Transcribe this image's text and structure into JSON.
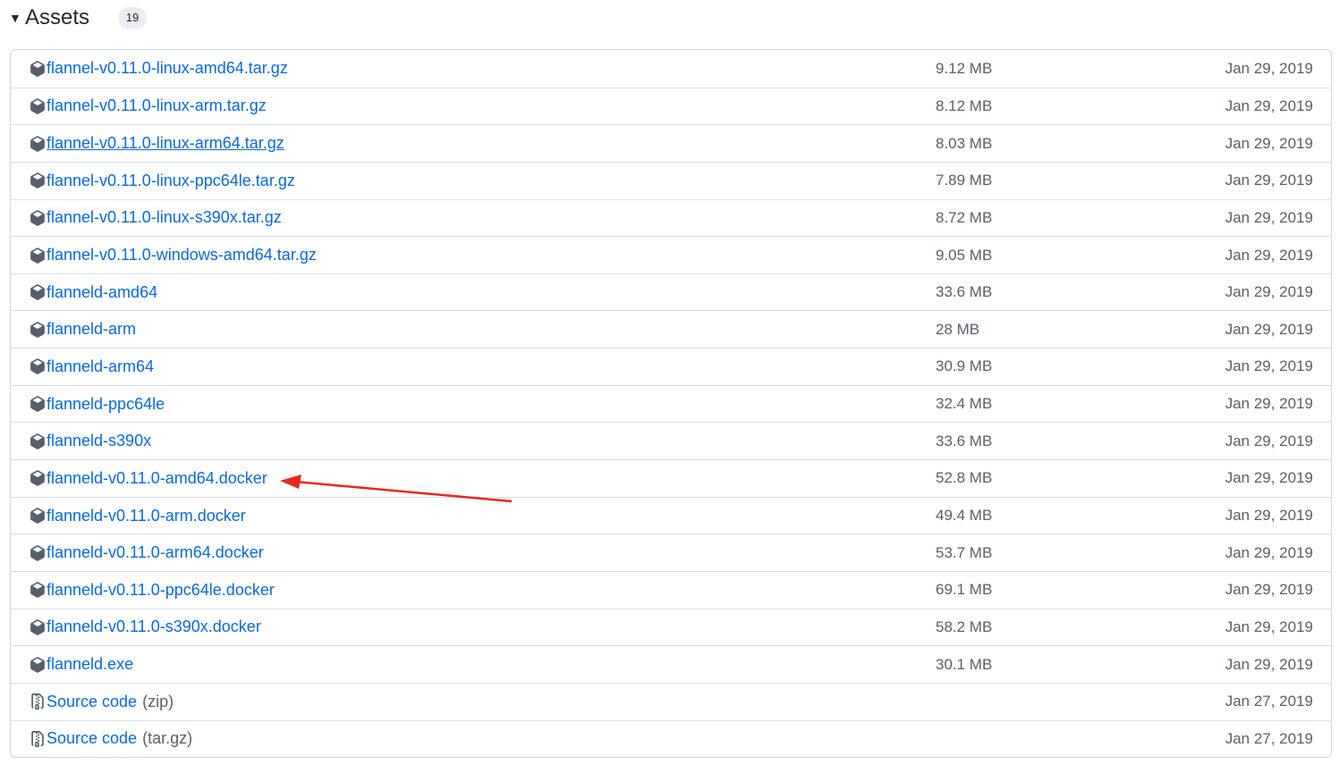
{
  "header": {
    "title": "Assets",
    "count": "19"
  },
  "assets": [
    {
      "name": "flannel-v0.11.0-linux-amd64.tar.gz",
      "size": "9.12 MB",
      "date": "Jan 29, 2019",
      "icon": "package-icon"
    },
    {
      "name": "flannel-v0.11.0-linux-arm.tar.gz",
      "size": "8.12 MB",
      "date": "Jan 29, 2019",
      "icon": "package-icon"
    },
    {
      "name": "flannel-v0.11.0-linux-arm64.tar.gz",
      "size": "8.03 MB",
      "date": "Jan 29, 2019",
      "icon": "package-icon",
      "hovered": true
    },
    {
      "name": "flannel-v0.11.0-linux-ppc64le.tar.gz",
      "size": "7.89 MB",
      "date": "Jan 29, 2019",
      "icon": "package-icon"
    },
    {
      "name": "flannel-v0.11.0-linux-s390x.tar.gz",
      "size": "8.72 MB",
      "date": "Jan 29, 2019",
      "icon": "package-icon"
    },
    {
      "name": "flannel-v0.11.0-windows-amd64.tar.gz",
      "size": "9.05 MB",
      "date": "Jan 29, 2019",
      "icon": "package-icon"
    },
    {
      "name": "flanneld-amd64",
      "size": "33.6 MB",
      "date": "Jan 29, 2019",
      "icon": "package-icon"
    },
    {
      "name": "flanneld-arm",
      "size": "28 MB",
      "date": "Jan 29, 2019",
      "icon": "package-icon"
    },
    {
      "name": "flanneld-arm64",
      "size": "30.9 MB",
      "date": "Jan 29, 2019",
      "icon": "package-icon"
    },
    {
      "name": "flanneld-ppc64le",
      "size": "32.4 MB",
      "date": "Jan 29, 2019",
      "icon": "package-icon"
    },
    {
      "name": "flanneld-s390x",
      "size": "33.6 MB",
      "date": "Jan 29, 2019",
      "icon": "package-icon"
    },
    {
      "name": "flanneld-v0.11.0-amd64.docker",
      "size": "52.8 MB",
      "date": "Jan 29, 2019",
      "icon": "package-icon"
    },
    {
      "name": "flanneld-v0.11.0-arm.docker",
      "size": "49.4 MB",
      "date": "Jan 29, 2019",
      "icon": "package-icon"
    },
    {
      "name": "flanneld-v0.11.0-arm64.docker",
      "size": "53.7 MB",
      "date": "Jan 29, 2019",
      "icon": "package-icon"
    },
    {
      "name": "flanneld-v0.11.0-ppc64le.docker",
      "size": "69.1 MB",
      "date": "Jan 29, 2019",
      "icon": "package-icon"
    },
    {
      "name": "flanneld-v0.11.0-s390x.docker",
      "size": "58.2 MB",
      "date": "Jan 29, 2019",
      "icon": "package-icon"
    },
    {
      "name": "flanneld.exe",
      "size": "30.1 MB",
      "date": "Jan 29, 2019",
      "icon": "package-icon"
    },
    {
      "name": "Source code",
      "suffix": "(zip)",
      "size": "",
      "date": "Jan 27, 2019",
      "icon": "file-zip-icon"
    },
    {
      "name": "Source code",
      "suffix": "(tar.gz)",
      "size": "",
      "date": "Jan 27, 2019",
      "icon": "file-zip-icon"
    }
  ],
  "colors": {
    "link": "#0969da",
    "muted": "#57606a",
    "border": "#d0d7de",
    "annotation_arrow": "#e8281e"
  }
}
